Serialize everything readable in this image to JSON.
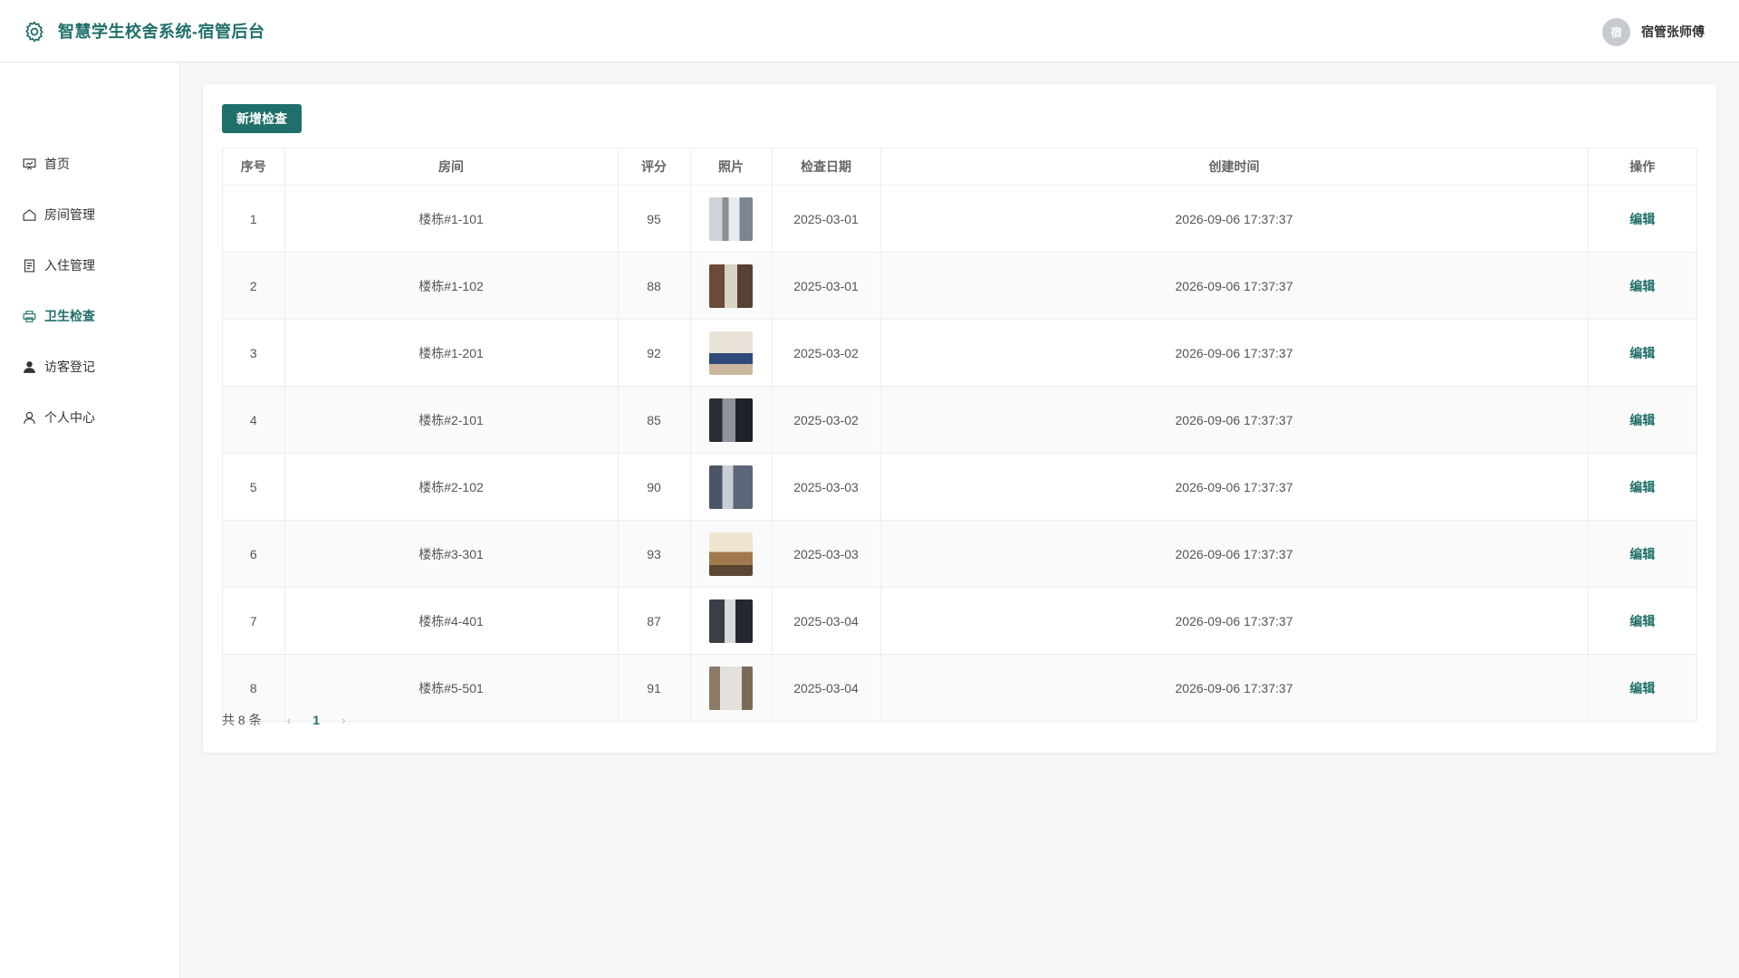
{
  "header": {
    "title": "智慧学生校舍系统-宿管后台",
    "avatar_text": "宿",
    "user_name": "宿管张师傅"
  },
  "sidebar": {
    "items": [
      {
        "label": "首页",
        "icon": "home-chart-icon"
      },
      {
        "label": "房间管理",
        "icon": "house-icon"
      },
      {
        "label": "入住管理",
        "icon": "document-icon"
      },
      {
        "label": "卫生检查",
        "icon": "printer-icon",
        "active": true
      },
      {
        "label": "访客登记",
        "icon": "user-filled-icon"
      },
      {
        "label": "个人中心",
        "icon": "user-outline-icon"
      }
    ]
  },
  "toolbar": {
    "new_label": "新增检查"
  },
  "table": {
    "headers": {
      "index": "序号",
      "room": "房间",
      "score": "评分",
      "photo": "照片",
      "date": "检查日期",
      "created": "创建时间",
      "action": "操作"
    },
    "rows": [
      {
        "index": "1",
        "room": "楼栋#1-101",
        "score": "95",
        "date": "2025-03-01",
        "created": "2026-09-06 17:37:37",
        "action": "编辑"
      },
      {
        "index": "2",
        "room": "楼栋#1-102",
        "score": "88",
        "date": "2025-03-01",
        "created": "2026-09-06 17:37:37",
        "action": "编辑"
      },
      {
        "index": "3",
        "room": "楼栋#1-201",
        "score": "92",
        "date": "2025-03-02",
        "created": "2026-09-06 17:37:37",
        "action": "编辑"
      },
      {
        "index": "4",
        "room": "楼栋#2-101",
        "score": "85",
        "date": "2025-03-02",
        "created": "2026-09-06 17:37:37",
        "action": "编辑"
      },
      {
        "index": "5",
        "room": "楼栋#2-102",
        "score": "90",
        "date": "2025-03-03",
        "created": "2026-09-06 17:37:37",
        "action": "编辑"
      },
      {
        "index": "6",
        "room": "楼栋#3-301",
        "score": "93",
        "date": "2025-03-03",
        "created": "2026-09-06 17:37:37",
        "action": "编辑"
      },
      {
        "index": "7",
        "room": "楼栋#4-401",
        "score": "87",
        "date": "2025-03-04",
        "created": "2026-09-06 17:37:37",
        "action": "编辑"
      },
      {
        "index": "8",
        "room": "楼栋#5-501",
        "score": "91",
        "date": "2025-03-04",
        "created": "2026-09-06 17:37:37",
        "action": "编辑"
      }
    ]
  },
  "pagination": {
    "total_text": "共 8 条",
    "prev": "‹",
    "current": "1",
    "next": "›"
  },
  "colors": {
    "accent": "#1f6f6a",
    "background": "#f6f7f9"
  }
}
